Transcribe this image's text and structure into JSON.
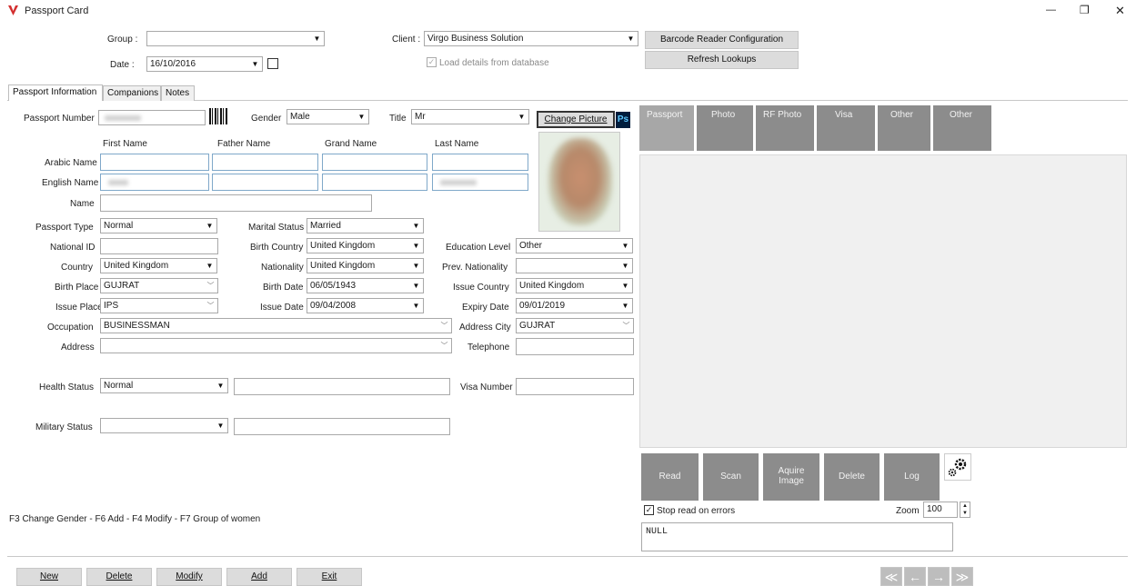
{
  "window": {
    "title": "Passport Card",
    "minimize": "—",
    "restore": "❐",
    "close": "✕"
  },
  "top": {
    "group_label": "Group :",
    "group_value": "",
    "date_label": "Date :",
    "date_value": "16/10/2016",
    "client_label": "Client :",
    "client_value": "Virgo Business Solution",
    "barcode_config_btn": "Barcode Reader Configuration",
    "refresh_btn": "Refresh Lookups",
    "load_details_label": "Load details from database"
  },
  "tabs": [
    "Passport Information",
    "Companions",
    "Notes"
  ],
  "form": {
    "passport_number_label": "Passport Number",
    "gender_label": "Gender",
    "gender_value": "Male",
    "title_label": "Title",
    "title_value": "Mr",
    "change_picture_btn": "Change Picture",
    "ps_badge": "Ps",
    "col_first": "First Name",
    "col_father": "Father Name",
    "col_grand": "Grand Name",
    "col_last": "Last Name",
    "arabic_name_label": "Arabic Name",
    "english_name_label": "English Name",
    "name_label": "Name",
    "passport_type_label": "Passport Type",
    "passport_type_value": "Normal",
    "marital_status_label": "Marital Status",
    "marital_status_value": "Married",
    "national_id_label": "National ID",
    "national_id_value": "",
    "birth_country_label": "Birth Country",
    "birth_country_value": "United Kingdom",
    "education_level_label": "Education Level",
    "education_level_value": "Other",
    "country_label": "Country",
    "country_value": "United Kingdom",
    "nationality_label": "Nationality",
    "nationality_value": "United Kingdom",
    "prev_nationality_label": "Prev. Nationality",
    "prev_nationality_value": "",
    "birth_place_label": "Birth Place",
    "birth_place_value": "GUJRAT",
    "birth_date_label": "Birth Date",
    "birth_date_value": "06/05/1943",
    "issue_country_label": "Issue Country",
    "issue_country_value": "United Kingdom",
    "issue_place_label": "Issue Place",
    "issue_place_value": "IPS",
    "issue_date_label": "Issue Date",
    "issue_date_value": "09/04/2008",
    "expiry_date_label": "Expiry Date",
    "expiry_date_value": "09/01/2019",
    "occupation_label": "Occupation",
    "occupation_value": "BUSINESSMAN",
    "address_city_label": "Address City",
    "address_city_value": "GUJRAT",
    "address_label": "Address",
    "address_value": "",
    "telephone_label": "Telephone",
    "telephone_value": "",
    "health_status_label": "Health Status",
    "health_status_value": "Normal",
    "visa_number_label": "Visa Number",
    "visa_number_value": "",
    "military_status_label": "Military Status",
    "military_status_value": ""
  },
  "hotkeys": "F3 Change Gender  - F6 Add  - F4 Modify  - F7 Group of women",
  "doc_tabs": [
    "Passport",
    "Photo",
    "RF Photo",
    "Visa",
    "Other",
    "Other"
  ],
  "scanner": {
    "read": "Read",
    "scan": "Scan",
    "acquire_line1": "Aquire",
    "acquire_line2": "Image",
    "delete": "Delete",
    "log": "Log",
    "stop_read_label": "Stop read on errors",
    "zoom_label": "Zoom",
    "zoom_value": "100",
    "log_text": "NULL"
  },
  "bottom_buttons": [
    "New",
    "Delete",
    "Modify",
    "Add",
    "Exit"
  ],
  "nav": [
    "≪",
    "←",
    "→",
    "≫"
  ],
  "colors": {
    "tile": "#8c8c8c",
    "tile_active": "#a7a7a7",
    "field_border_blue": "#7fa8c9",
    "ps_blue": "#001d3d"
  }
}
